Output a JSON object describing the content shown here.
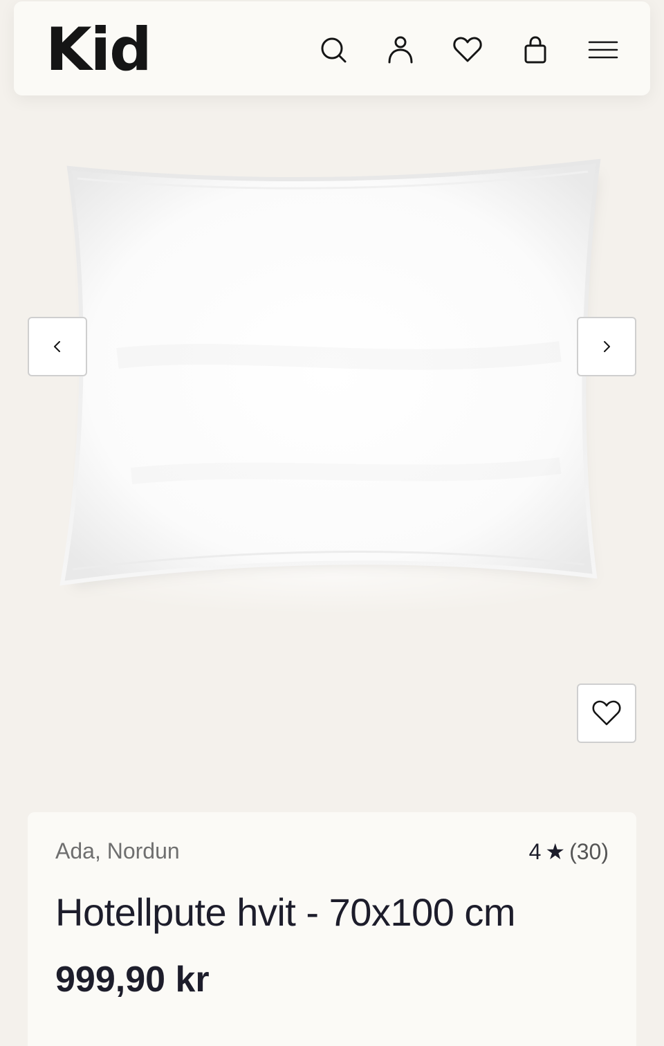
{
  "header": {
    "logo": "Kid",
    "icons": [
      "search-icon",
      "user-icon",
      "heart-icon",
      "bag-icon",
      "menu-icon"
    ]
  },
  "gallery": {
    "image": "pillow",
    "prev_icon": "chevron-left-icon",
    "next_icon": "chevron-right-icon",
    "favorite_icon": "heart-icon"
  },
  "product": {
    "brand": "Ada, Nordun",
    "rating_value": "4",
    "rating_star": "★",
    "rating_count": "(30)",
    "title": "Hotellpute hvit - 70x100 cm",
    "price": "999,90 kr"
  },
  "colors": {
    "background": "#f4f1ec",
    "surface": "#fbfaf6",
    "text": "#1d1d2b"
  }
}
